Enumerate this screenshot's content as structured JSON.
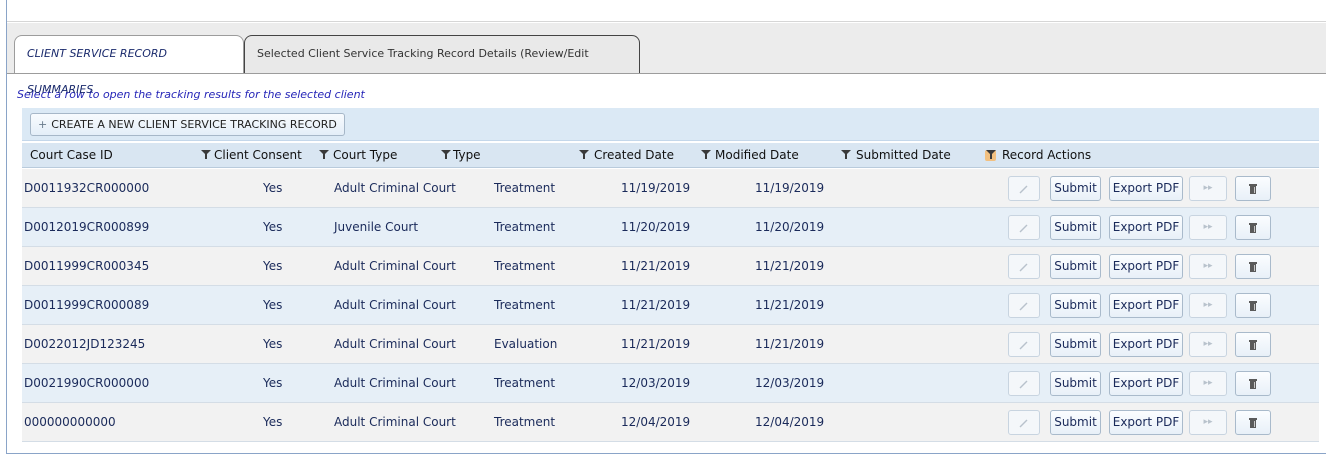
{
  "tabs": [
    {
      "label": "CLIENT SERVICE RECORD SUMMARIES",
      "active": true
    },
    {
      "label": "Selected Client Service Tracking Record Details (Review/Edit Answers)",
      "active": false
    }
  ],
  "hint": "Select a row to open the tracking results for the selected client",
  "toolbar": {
    "create_label": "CREATE A NEW CLIENT SERVICE TRACKING RECORD",
    "create_icon": "+"
  },
  "columns": [
    "Court Case ID",
    "Client Consent",
    "Court Type",
    "Type",
    "Created Date",
    "Modified Date",
    "Submitted Date",
    "Record Actions"
  ],
  "actions": {
    "submit_label": "Submit",
    "export_label": "Export PDF",
    "next_icon": "▸▸"
  },
  "rows": [
    {
      "case_id": "D0011932CR000000",
      "consent": "Yes",
      "court_type": "Adult Criminal Court",
      "type": "Treatment",
      "created": "11/19/2019",
      "modified": "11/19/2019",
      "submitted": ""
    },
    {
      "case_id": "D0012019CR000899",
      "consent": "Yes",
      "court_type": "Juvenile Court",
      "type": "Treatment",
      "created": "11/20/2019",
      "modified": "11/20/2019",
      "submitted": ""
    },
    {
      "case_id": "D0011999CR000345",
      "consent": "Yes",
      "court_type": "Adult Criminal Court",
      "type": "Treatment",
      "created": "11/21/2019",
      "modified": "11/21/2019",
      "submitted": ""
    },
    {
      "case_id": "D0011999CR000089",
      "consent": "Yes",
      "court_type": "Adult Criminal Court",
      "type": "Treatment",
      "created": "11/21/2019",
      "modified": "11/21/2019",
      "submitted": ""
    },
    {
      "case_id": "D0022012JD123245",
      "consent": "Yes",
      "court_type": "Adult Criminal Court",
      "type": "Evaluation",
      "created": "11/21/2019",
      "modified": "11/21/2019",
      "submitted": ""
    },
    {
      "case_id": "D0021990CR000000",
      "consent": "Yes",
      "court_type": "Adult Criminal Court",
      "type": "Treatment",
      "created": "12/03/2019",
      "modified": "12/03/2019",
      "submitted": ""
    },
    {
      "case_id": "000000000000",
      "consent": "Yes",
      "court_type": "Adult Criminal Court",
      "type": "Treatment",
      "created": "12/04/2019",
      "modified": "12/04/2019",
      "submitted": ""
    }
  ],
  "colors": {
    "hint_text": "#2626b8",
    "header_bg": "#d9e6f2",
    "row_alt_bg": "#e6eff7",
    "active_filter": "#f2c080"
  },
  "icons": {
    "edit": "pencil-icon",
    "next": "fast-forward-icon",
    "delete": "trash-icon",
    "filter": "filter-icon"
  }
}
